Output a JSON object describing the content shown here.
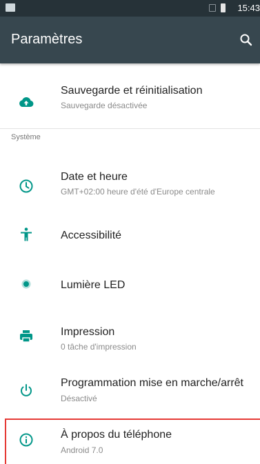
{
  "status_bar": {
    "time": "15:43"
  },
  "app_bar": {
    "title": "Paramètres"
  },
  "items": [
    {
      "title": "Sauvegarde et réinitialisation",
      "subtitle": "Sauvegarde désactivée",
      "icon": "cloud-upload-icon"
    },
    {
      "title": "Date et heure",
      "subtitle": "GMT+02:00 heure d'été d'Europe centrale",
      "icon": "clock-icon"
    },
    {
      "title": "Accessibilité",
      "icon": "accessibility-icon"
    },
    {
      "title": "Lumière LED",
      "icon": "led-light-icon"
    },
    {
      "title": "Impression",
      "subtitle": "0 tâche d'impression",
      "icon": "printer-icon"
    },
    {
      "title": "Programmation mise en marche/arrêt",
      "subtitle": "Désactivé",
      "icon": "power-schedule-icon"
    },
    {
      "title": "À propos du téléphone",
      "subtitle": "Android 7.0",
      "icon": "info-icon"
    }
  ],
  "sections": {
    "system": "Système"
  },
  "colors": {
    "accent": "#009688",
    "app_bar": "#37474f",
    "status_bar": "#263238",
    "highlight": "#e53935"
  }
}
